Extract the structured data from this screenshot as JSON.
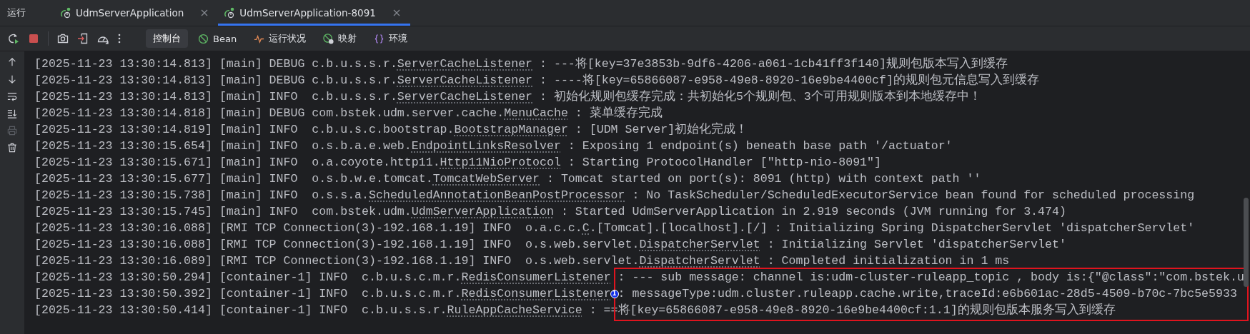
{
  "panel_title": "运行",
  "run_tabs": [
    {
      "label": "UdmServerApplication",
      "selected": false
    },
    {
      "label": "UdmServerApplication-8091",
      "selected": true
    }
  ],
  "actions": [
    {
      "kind": "rerun"
    },
    {
      "kind": "stop"
    },
    {
      "kind": "divider"
    },
    {
      "kind": "camera"
    },
    {
      "kind": "exit"
    },
    {
      "kind": "gauge"
    },
    {
      "kind": "more"
    }
  ],
  "view_tabs": [
    {
      "kind": "console",
      "label": "控制台",
      "selected": true
    },
    {
      "kind": "bean",
      "label": "Bean",
      "selected": false
    },
    {
      "kind": "health",
      "label": "运行状况",
      "selected": false
    },
    {
      "kind": "mapping",
      "label": "映射",
      "selected": false
    },
    {
      "kind": "env",
      "label": "环境",
      "selected": false
    }
  ],
  "gutter_tools": [
    {
      "kind": "up",
      "disabled": false
    },
    {
      "kind": "down",
      "disabled": false
    },
    {
      "kind": "wrap",
      "disabled": false
    },
    {
      "kind": "scroll-end",
      "disabled": false
    },
    {
      "kind": "print",
      "disabled": true
    },
    {
      "kind": "trash",
      "disabled": false
    }
  ],
  "log_lines": [
    {
      "timestamp": "[2025-11-23 13:30:14.813]",
      "thread": "[main]",
      "level": "DEBUG",
      "package": "c.b.u.s.s.r.",
      "class": "ServerCacheListener",
      "message": ": ---将[key=37e3853b-9df6-4206-a061-1cb41ff3f140]规则包版本写入到缓存",
      "boxed": false
    },
    {
      "timestamp": "[2025-11-23 13:30:14.813]",
      "thread": "[main]",
      "level": "DEBUG",
      "package": "c.b.u.s.s.r.",
      "class": "ServerCacheListener",
      "message": ": ----将[key=65866087-e958-49e8-8920-16e9be4400cf]的规则包元信息写入到缓存",
      "boxed": false
    },
    {
      "timestamp": "[2025-11-23 13:30:14.813]",
      "thread": "[main]",
      "level": "INFO",
      "package": "c.b.u.s.s.r.",
      "class": "ServerCacheListener",
      "message": ": 初始化规则包缓存完成：共初始化5个规则包、3个可用规则版本到本地缓存中！",
      "boxed": false
    },
    {
      "timestamp": "[2025-11-23 13:30:14.818]",
      "thread": "[main]",
      "level": "DEBUG",
      "package": "com.bstek.udm.server.cache.",
      "class": "MenuCache",
      "message": ": 菜单缓存完成",
      "boxed": false
    },
    {
      "timestamp": "[2025-11-23 13:30:14.819]",
      "thread": "[main]",
      "level": "INFO",
      "package": "c.b.u.s.c.bootstrap.",
      "class": "BootstrapManager",
      "message": ": [UDM Server]初始化完成！",
      "boxed": false
    },
    {
      "timestamp": "[2025-11-23 13:30:15.654]",
      "thread": "[main]",
      "level": "INFO",
      "package": "o.s.b.a.e.web.",
      "class": "EndpointLinksResolver",
      "message": ": Exposing 1 endpoint(s) beneath base path '/actuator'",
      "boxed": false
    },
    {
      "timestamp": "[2025-11-23 13:30:15.671]",
      "thread": "[main]",
      "level": "INFO",
      "package": "o.a.coyote.http11.",
      "class": "Http11NioProtocol",
      "message": ": Starting ProtocolHandler [\"http-nio-8091\"]",
      "boxed": false
    },
    {
      "timestamp": "[2025-11-23 13:30:15.677]",
      "thread": "[main]",
      "level": "INFO",
      "package": "o.s.b.w.e.tomcat.",
      "class": "TomcatWebServer",
      "message": ": Tomcat started on port(s): 8091 (http) with context path ''",
      "boxed": false
    },
    {
      "timestamp": "[2025-11-23 13:30:15.738]",
      "thread": "[main]",
      "level": "INFO",
      "package": "o.s.s.a.",
      "class": "ScheduledAnnotationBeanPostProcessor",
      "message": ": No TaskScheduler/ScheduledExecutorService bean found for scheduled processing",
      "boxed": false
    },
    {
      "timestamp": "[2025-11-23 13:30:15.745]",
      "thread": "[main]",
      "level": "INFO",
      "package": "com.bstek.udm.",
      "class": "UdmServerApplication",
      "message": ": Started UdmServerApplication in 2.919 seconds (JVM running for 3.474)",
      "boxed": false
    },
    {
      "timestamp": "[2025-11-23 13:30:16.088]",
      "thread": "[RMI TCP Connection(3)-192.168.1.19]",
      "level": "INFO",
      "package": "o.a.c.c.",
      "class": "C",
      "logger_suffix": ".[Tomcat].[localhost].[/]",
      "message": ": Initializing Spring DispatcherServlet 'dispatcherServlet'",
      "boxed": false
    },
    {
      "timestamp": "[2025-11-23 13:30:16.088]",
      "thread": "[RMI TCP Connection(3)-192.168.1.19]",
      "level": "INFO",
      "package": "o.s.web.servlet.",
      "class": "DispatcherServlet",
      "message": ": Initializing Servlet 'dispatcherServlet'",
      "boxed": false
    },
    {
      "timestamp": "[2025-11-23 13:30:16.089]",
      "thread": "[RMI TCP Connection(3)-192.168.1.19]",
      "level": "INFO",
      "package": "o.s.web.servlet.",
      "class": "DispatcherServlet",
      "message": ": Completed initialization in 1 ms",
      "boxed": false
    },
    {
      "timestamp": "[2025-11-23 13:30:50.294]",
      "thread": "[container-1]",
      "level": "INFO",
      "package": "c.b.u.s.c.m.r.",
      "class": "RedisConsumerListener",
      "message": ": --- sub message: channel is:udm-cluster-ruleapp_topic , body is:{\"@class\":\"com.bstek.u",
      "boxed": true
    },
    {
      "timestamp": "[2025-11-23 13:30:50.392]",
      "thread": "[container-1]",
      "level": "INFO",
      "package": "c.b.u.s.c.m.r.",
      "class": "RedisConsumerListener",
      "message": ": messageType:udm.cluster.ruleapp.cache.write,traceId:e6b601ac-28d5-4509-b70c-7bc5e5933",
      "boxed": true
    },
    {
      "timestamp": "[2025-11-23 13:30:50.414]",
      "thread": "[container-1]",
      "level": "INFO",
      "package": "c.b.u.s.s.r.",
      "class": "RuleAppCacheService",
      "message": ": ==将[key=65866087-e958-49e8-8920-16e9be4400cf:1.1]的规则包版本服务写入到缓存",
      "boxed": true
    }
  ],
  "annotation": {
    "badge": "1"
  }
}
